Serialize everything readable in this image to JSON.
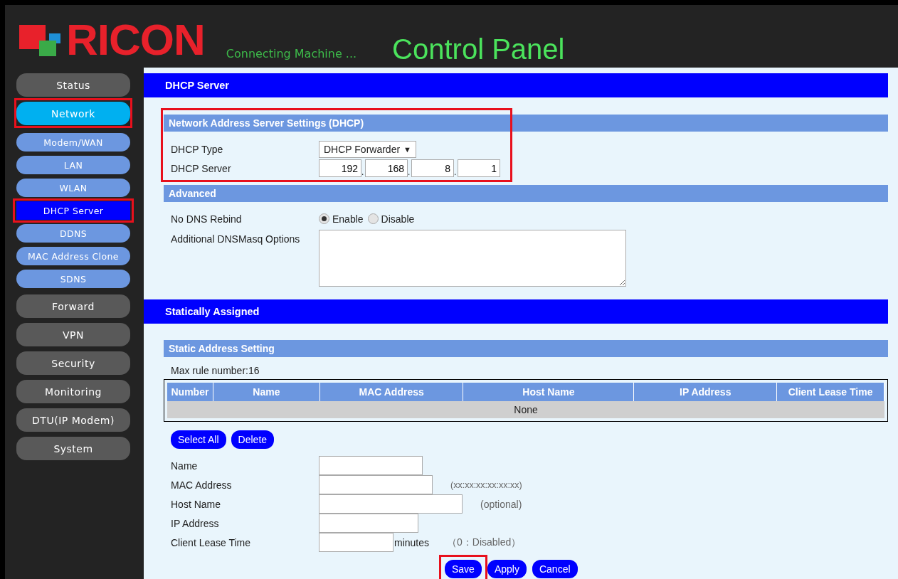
{
  "header": {
    "logo": "RICON",
    "tagline": "Connecting Machine ...",
    "title": "Control Panel"
  },
  "sidebar": {
    "items": [
      {
        "label": "Status",
        "selected": false,
        "annotated": false
      },
      {
        "label": "Network",
        "selected": true,
        "annotated": true,
        "children": [
          {
            "label": "Modem/WAN",
            "selected": false,
            "annotated": false
          },
          {
            "label": "LAN",
            "selected": false,
            "annotated": false
          },
          {
            "label": "WLAN",
            "selected": false,
            "annotated": false
          },
          {
            "label": "DHCP Server",
            "selected": true,
            "annotated": true
          },
          {
            "label": "DDNS",
            "selected": false,
            "annotated": false
          },
          {
            "label": "MAC Address Clone",
            "selected": false,
            "annotated": false
          },
          {
            "label": "SDNS",
            "selected": false,
            "annotated": false
          }
        ]
      },
      {
        "label": "Forward",
        "selected": false,
        "annotated": false
      },
      {
        "label": "VPN",
        "selected": false,
        "annotated": false
      },
      {
        "label": "Security",
        "selected": false,
        "annotated": false
      },
      {
        "label": "Monitoring",
        "selected": false,
        "annotated": false
      },
      {
        "label": "DTU(IP Modem)",
        "selected": false,
        "annotated": false
      },
      {
        "label": "System",
        "selected": false,
        "annotated": false
      }
    ]
  },
  "page_title": "DHCP Server",
  "dhcp_settings": {
    "title": "Network Address Server Settings (DHCP)",
    "annotated": true,
    "type_label": "DHCP Type",
    "type_value": "DHCP Forwarder",
    "type_caret": "▼",
    "server_label": "DHCP Server",
    "server_octets": [
      "192",
      "168",
      "8",
      "1"
    ],
    "octet_separator": "."
  },
  "advanced": {
    "title": "Advanced",
    "rebind_label": "No DNS Rebind",
    "rebind_options": [
      {
        "label": "Enable",
        "selected": true
      },
      {
        "label": "Disable",
        "selected": false
      }
    ],
    "dnsmasq_label": "Additional DNSMasq Options"
  },
  "static_title": "Statically Assigned",
  "static_setting": {
    "title": "Static Address Setting",
    "max_rule": "Max rule number:16",
    "columns": [
      "Number",
      "Name",
      "MAC Address",
      "Host Name",
      "IP Address",
      "Client Lease Time"
    ],
    "empty_text": "None",
    "buttons": [
      "Select All",
      "Delete"
    ]
  },
  "form": [
    {
      "label": "Name"
    },
    {
      "label": "MAC Address",
      "hint": "(xx:xx:xx:xx:xx:xx)"
    },
    {
      "label": "Host Name",
      "hint": "(optional)"
    },
    {
      "label": "IP Address"
    },
    {
      "label": "Client Lease Time",
      "suffix": "minutes",
      "hint": "（0：Disabled）"
    }
  ],
  "actions": [
    {
      "label": "Save",
      "annotated": true
    },
    {
      "label": "Apply",
      "annotated": false
    },
    {
      "label": "Cancel",
      "annotated": false
    }
  ]
}
